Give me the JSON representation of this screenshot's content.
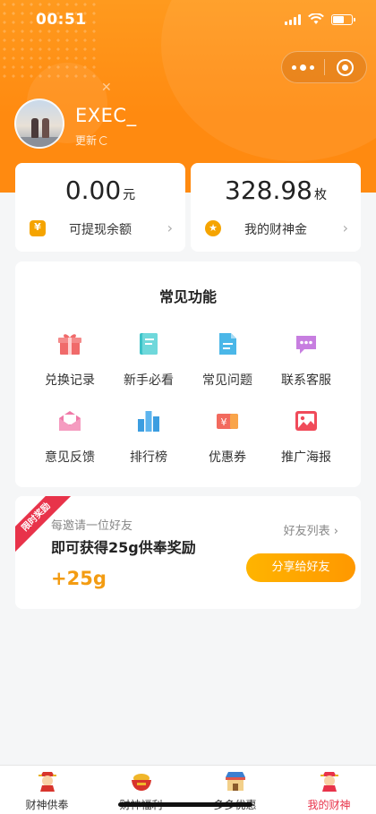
{
  "status_bar": {
    "time": "00:51"
  },
  "profile": {
    "username": "EXEC_",
    "refresh_label": "更新"
  },
  "balance": {
    "cash": {
      "amount": "0.00",
      "unit": "元",
      "label": "可提现余额"
    },
    "coins": {
      "amount": "328.98",
      "unit": "枚",
      "label": "我的财神金"
    }
  },
  "functions": {
    "title": "常见功能",
    "items": [
      {
        "label": "兑换记录",
        "icon": "gift-icon"
      },
      {
        "label": "新手必看",
        "icon": "book-icon"
      },
      {
        "label": "常见问题",
        "icon": "document-icon"
      },
      {
        "label": "联系客服",
        "icon": "chat-icon"
      },
      {
        "label": "意见反馈",
        "icon": "envelope-icon"
      },
      {
        "label": "排行榜",
        "icon": "bar-chart-icon"
      },
      {
        "label": "优惠券",
        "icon": "coupon-icon"
      },
      {
        "label": "推广海报",
        "icon": "poster-icon"
      }
    ]
  },
  "invite": {
    "ribbon": "限时奖励",
    "subtitle": "每邀请一位好友",
    "title": "即可获得25g供奉奖励",
    "reward": "+25g",
    "friend_list": "好友列表",
    "share_button": "分享给好友"
  },
  "tabbar": {
    "tabs": [
      {
        "label": "财神供奉",
        "icon": "god-of-wealth-icon"
      },
      {
        "label": "财神福利",
        "icon": "treasure-bowl-icon"
      },
      {
        "label": "多多优惠",
        "icon": "shop-icon"
      },
      {
        "label": "我的财神",
        "icon": "profile-god-icon"
      }
    ],
    "active_index": 3
  },
  "colors": {
    "header": "#ff8a10",
    "accent_red": "#e8334a",
    "gold": "#f5a400"
  }
}
